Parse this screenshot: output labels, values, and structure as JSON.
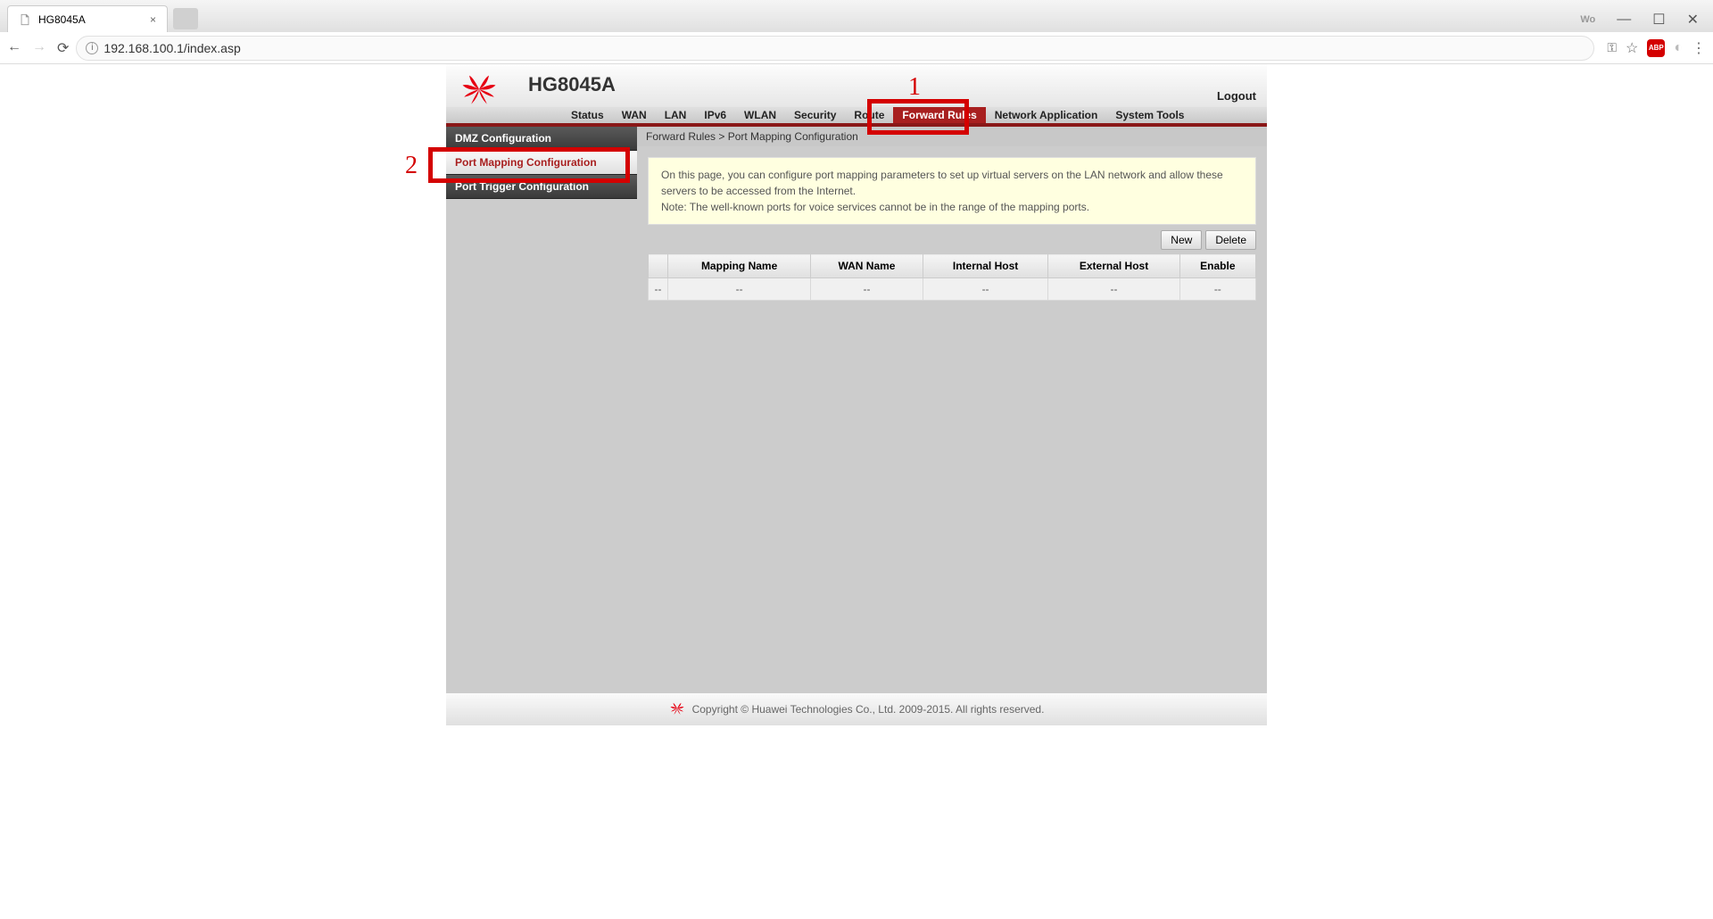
{
  "browser": {
    "tab_title": "HG8045A",
    "url": "192.168.100.1/index.asp"
  },
  "header": {
    "brand": "HUAWEI",
    "model": "HG8045A",
    "logout": "Logout"
  },
  "top_nav": {
    "items": [
      {
        "label": "Status"
      },
      {
        "label": "WAN"
      },
      {
        "label": "LAN"
      },
      {
        "label": "IPv6"
      },
      {
        "label": "WLAN"
      },
      {
        "label": "Security"
      },
      {
        "label": "Route"
      },
      {
        "label": "Forward Rules"
      },
      {
        "label": "Network Application"
      },
      {
        "label": "System Tools"
      }
    ],
    "active_index": 7
  },
  "sidebar": {
    "items": [
      {
        "label": "DMZ Configuration"
      },
      {
        "label": "Port Mapping Configuration"
      },
      {
        "label": "Port Trigger Configuration"
      }
    ],
    "active_index": 1
  },
  "breadcrumb": "Forward Rules > Port Mapping Configuration",
  "info_box": {
    "line1": "On this page, you can configure port mapping parameters to set up virtual servers on the LAN network and allow these servers to be accessed from the Internet.",
    "line2": "Note: The well-known ports for voice services cannot be in the range of the mapping ports."
  },
  "table_actions": {
    "new": "New",
    "delete": "Delete"
  },
  "table": {
    "headers": [
      "",
      "Mapping Name",
      "WAN Name",
      "Internal Host",
      "External Host",
      "Enable"
    ],
    "rows": [
      [
        "--",
        "--",
        "--",
        "--",
        "--",
        "--"
      ]
    ]
  },
  "footer": {
    "copyright": "Copyright © Huawei Technologies Co., Ltd. 2009-2015. All rights reserved."
  },
  "annotations": {
    "label1": "1",
    "label2": "2"
  }
}
